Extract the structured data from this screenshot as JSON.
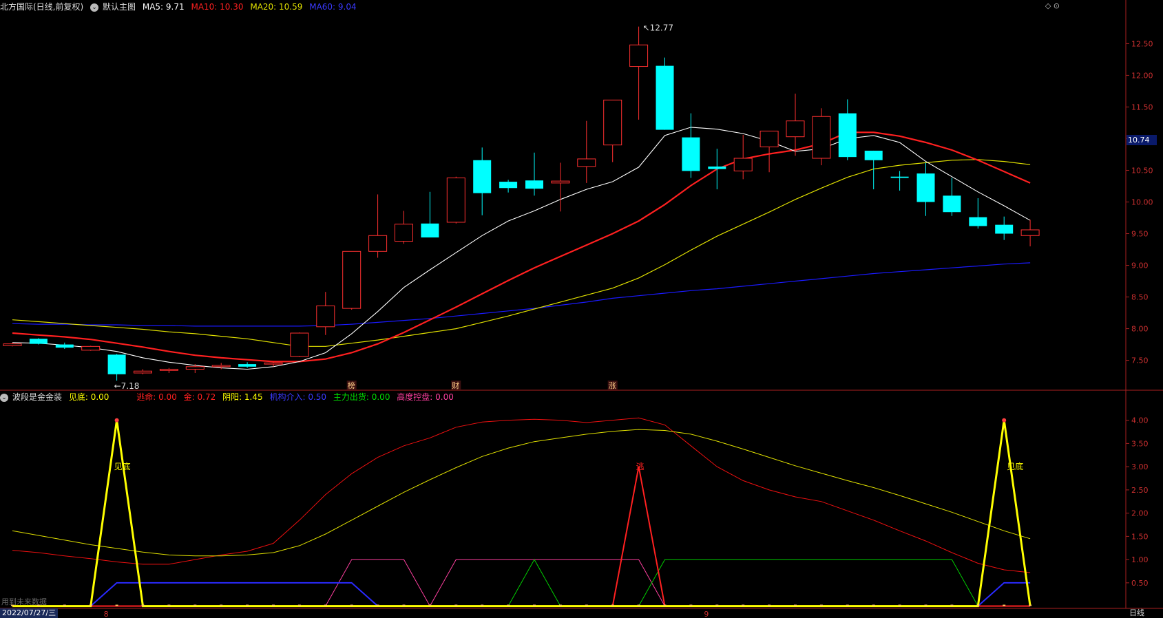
{
  "header": {
    "stock_title": "北方国际(日线,前复权)",
    "chart_mode": "默认主图",
    "ma5_label": "MA5: 9.71",
    "ma10_label": "MA10: 10.30",
    "ma20_label": "MA20: 10.59",
    "ma60_label": "MA60: 9.04"
  },
  "indicator_header": {
    "name": "波段是金金装",
    "items": [
      {
        "label": "见底: 0.00",
        "color": "#ffff00"
      },
      {
        "label": "逃命: 0.00",
        "color": "#ff2020"
      },
      {
        "label": "金: 0.72",
        "color": "#ff2020"
      },
      {
        "label": "阴阳: 1.45",
        "color": "#ffff00"
      },
      {
        "label": "机构介入: 0.50",
        "color": "#3a3aff"
      },
      {
        "label": "主力出货: 0.00",
        "color": "#00e000"
      },
      {
        "label": "高度控盘: 0.00",
        "color": "#ff40a0"
      }
    ]
  },
  "colors": {
    "up": "#ff3030",
    "down": "#00ffff",
    "ma5": "#ffffff",
    "ma10": "#ff2020",
    "ma20": "#e0e000",
    "ma60": "#1a1aff",
    "axis": "#aa2020"
  },
  "current_price": "10.74",
  "footer": {
    "date": "2022/07/27/三",
    "period": "日线",
    "hint": "用到未来数据"
  },
  "markers": [
    {
      "text": "榜",
      "index": 13
    },
    {
      "text": "财",
      "index": 17
    },
    {
      "text": "涨",
      "index": 23
    }
  ],
  "annotations": {
    "high": "12.77",
    "low": "7.18",
    "signal1": "见底",
    "signal2": "逃",
    "signal3": "见底"
  },
  "month_labels": [
    {
      "text": "8",
      "index": 3.5
    },
    {
      "text": "9",
      "index": 26.5
    }
  ],
  "chart_data": [
    {
      "type": "candlestick",
      "x": [
        1,
        2,
        3,
        4,
        5,
        6,
        7,
        8,
        9,
        10,
        11,
        12,
        13,
        14,
        15,
        16,
        17,
        18,
        19,
        20,
        21,
        22,
        23,
        24,
        25,
        26,
        27,
        28,
        29,
        30,
        31,
        32,
        33,
        34,
        35,
        36,
        37,
        38,
        39,
        40
      ],
      "ohlc": [
        [
          7.73,
          7.78,
          7.72,
          7.76
        ],
        [
          7.84,
          7.85,
          7.75,
          7.76
        ],
        [
          7.75,
          7.78,
          7.68,
          7.7
        ],
        [
          7.66,
          7.73,
          7.65,
          7.72
        ],
        [
          7.59,
          7.6,
          7.18,
          7.28
        ],
        [
          7.3,
          7.36,
          7.28,
          7.33
        ],
        [
          7.34,
          7.38,
          7.3,
          7.36
        ],
        [
          7.36,
          7.44,
          7.3,
          7.4
        ],
        [
          7.4,
          7.46,
          7.36,
          7.42
        ],
        [
          7.44,
          7.47,
          7.38,
          7.4
        ],
        [
          7.44,
          7.48,
          7.4,
          7.46
        ],
        [
          7.56,
          7.94,
          7.55,
          7.93
        ],
        [
          8.03,
          8.58,
          7.9,
          8.36
        ],
        [
          8.32,
          9.22,
          8.3,
          9.22
        ],
        [
          9.22,
          10.12,
          9.12,
          9.47
        ],
        [
          9.38,
          9.86,
          9.34,
          9.65
        ],
        [
          9.66,
          10.16,
          9.58,
          9.44
        ],
        [
          9.68,
          10.4,
          9.66,
          10.38
        ],
        [
          10.66,
          10.86,
          9.79,
          10.14
        ],
        [
          10.32,
          10.35,
          10.15,
          10.22
        ],
        [
          10.34,
          10.78,
          10.1,
          10.21
        ],
        [
          10.3,
          10.62,
          9.85,
          10.33
        ],
        [
          10.56,
          11.28,
          10.3,
          10.68
        ],
        [
          10.9,
          11.61,
          10.63,
          11.61
        ],
        [
          12.14,
          12.77,
          11.3,
          12.48
        ],
        [
          12.15,
          12.28,
          11.14,
          11.14
        ],
        [
          11.02,
          11.4,
          10.38,
          10.49
        ],
        [
          10.56,
          10.84,
          10.2,
          10.52
        ],
        [
          10.49,
          11.06,
          10.36,
          10.69
        ],
        [
          10.87,
          11.12,
          10.47,
          11.12
        ],
        [
          11.03,
          11.71,
          10.73,
          11.28
        ],
        [
          10.69,
          11.48,
          10.58,
          11.35
        ],
        [
          11.4,
          11.62,
          10.66,
          10.71
        ],
        [
          10.81,
          10.81,
          10.2,
          10.66
        ],
        [
          10.4,
          10.49,
          10.18,
          10.38
        ],
        [
          10.45,
          10.62,
          9.78,
          10.0
        ],
        [
          10.1,
          10.38,
          9.78,
          9.84
        ],
        [
          9.76,
          10.06,
          9.58,
          9.62
        ],
        [
          9.64,
          9.77,
          9.4,
          9.5
        ],
        [
          9.47,
          9.72,
          9.3,
          9.56
        ]
      ],
      "ma5": [
        7.78,
        7.77,
        7.74,
        7.7,
        7.64,
        7.54,
        7.47,
        7.42,
        7.38,
        7.36,
        7.4,
        7.48,
        7.62,
        7.92,
        8.27,
        8.65,
        8.93,
        9.2,
        9.47,
        9.7,
        9.86,
        10.04,
        10.2,
        10.32,
        10.55,
        11.05,
        11.18,
        11.15,
        11.08,
        10.96,
        10.8,
        10.84,
        11.0,
        11.05,
        10.94,
        10.64,
        10.4,
        10.16,
        9.94,
        9.71
      ],
      "ma10": [
        7.93,
        7.9,
        7.87,
        7.83,
        7.77,
        7.71,
        7.64,
        7.58,
        7.54,
        7.51,
        7.48,
        7.48,
        7.52,
        7.62,
        7.76,
        7.94,
        8.14,
        8.34,
        8.55,
        8.76,
        8.96,
        9.14,
        9.32,
        9.5,
        9.7,
        9.96,
        10.26,
        10.52,
        10.68,
        10.76,
        10.82,
        10.92,
        11.1,
        11.1,
        11.04,
        10.94,
        10.82,
        10.66,
        10.48,
        10.3
      ],
      "ma20": [
        8.14,
        8.11,
        8.08,
        8.05,
        8.02,
        7.99,
        7.95,
        7.92,
        7.88,
        7.84,
        7.78,
        7.72,
        7.72,
        7.77,
        7.82,
        7.88,
        7.94,
        8.0,
        8.1,
        8.2,
        8.31,
        8.42,
        8.53,
        8.64,
        8.8,
        9.01,
        9.24,
        9.46,
        9.65,
        9.84,
        10.04,
        10.22,
        10.39,
        10.52,
        10.58,
        10.62,
        10.66,
        10.67,
        10.64,
        10.59
      ],
      "ma60": [
        8.08,
        8.07,
        8.07,
        8.06,
        8.06,
        8.05,
        8.05,
        8.04,
        8.04,
        8.04,
        8.04,
        8.04,
        8.05,
        8.07,
        8.1,
        8.13,
        8.16,
        8.2,
        8.24,
        8.28,
        8.32,
        8.37,
        8.42,
        8.48,
        8.52,
        8.56,
        8.6,
        8.63,
        8.67,
        8.71,
        8.75,
        8.79,
        8.83,
        8.87,
        8.9,
        8.93,
        8.96,
        8.99,
        9.02,
        9.04
      ],
      "ylim": [
        7.05,
        12.95
      ],
      "y_ticks": [
        "7.50",
        "8.00",
        "8.50",
        "9.00",
        "9.50",
        "10.00",
        "10.50",
        "11.00",
        "11.50",
        "12.00",
        "12.50"
      ]
    },
    {
      "type": "line",
      "x": [
        1,
        2,
        3,
        4,
        5,
        6,
        7,
        8,
        9,
        10,
        11,
        12,
        13,
        14,
        15,
        16,
        17,
        18,
        19,
        20,
        21,
        22,
        23,
        24,
        25,
        26,
        27,
        28,
        29,
        30,
        31,
        32,
        33,
        34,
        35,
        36,
        37,
        38,
        39,
        40
      ],
      "ylim": [
        -0.05,
        4.35
      ],
      "y_ticks": [
        "0.50",
        "1.00",
        "1.50",
        "2.00",
        "2.50",
        "3.00",
        "3.50",
        "4.00"
      ],
      "series": [
        {
          "name": "见底",
          "color": "#ffff00",
          "width": 3,
          "values": [
            0,
            0,
            0,
            0,
            4,
            0,
            0,
            0,
            0,
            0,
            0,
            0,
            0,
            0,
            0,
            0,
            0,
            0,
            0,
            0,
            0,
            0,
            0,
            0,
            0,
            0,
            0,
            0,
            0,
            0,
            0,
            0,
            0,
            0,
            0,
            0,
            0,
            0,
            4,
            0
          ]
        },
        {
          "name": "逃命",
          "color": "#ff2020",
          "width": 2,
          "values": [
            0,
            0,
            0,
            0,
            0,
            0,
            0,
            0,
            0,
            0,
            0,
            0,
            0,
            0,
            0,
            0,
            0,
            0,
            0,
            0,
            0,
            0,
            0,
            0,
            3,
            0,
            0,
            0,
            0,
            0,
            0,
            0,
            0,
            0,
            0,
            0,
            0,
            0,
            0,
            0
          ]
        },
        {
          "name": "金",
          "color": "#ee1010",
          "width": 1,
          "values": [
            1.2,
            1.15,
            1.08,
            1.02,
            0.95,
            0.9,
            0.9,
            1.0,
            1.1,
            1.18,
            1.35,
            1.85,
            2.4,
            2.85,
            3.2,
            3.45,
            3.62,
            3.85,
            3.96,
            4.0,
            4.02,
            4.0,
            3.95,
            4.0,
            4.05,
            3.9,
            3.45,
            3.0,
            2.7,
            2.5,
            2.35,
            2.25,
            2.05,
            1.85,
            1.62,
            1.4,
            1.15,
            0.92,
            0.78,
            0.72
          ]
        },
        {
          "name": "阴阳",
          "color": "#e0e000",
          "width": 1,
          "values": [
            1.62,
            1.52,
            1.42,
            1.32,
            1.24,
            1.16,
            1.1,
            1.08,
            1.08,
            1.1,
            1.15,
            1.3,
            1.55,
            1.85,
            2.15,
            2.45,
            2.72,
            2.98,
            3.22,
            3.4,
            3.54,
            3.62,
            3.7,
            3.76,
            3.8,
            3.78,
            3.7,
            3.55,
            3.38,
            3.2,
            3.02,
            2.86,
            2.7,
            2.55,
            2.38,
            2.2,
            2.02,
            1.82,
            1.62,
            1.45
          ]
        },
        {
          "name": "机构介入",
          "color": "#2a2aff",
          "width": 2,
          "values": [
            0,
            0,
            0,
            0,
            0.5,
            0.5,
            0.5,
            0.5,
            0.5,
            0.5,
            0.5,
            0.5,
            0.5,
            0.5,
            0,
            0,
            0,
            0,
            0,
            0,
            0,
            0,
            0,
            0,
            0,
            0,
            0,
            0,
            0,
            0,
            0,
            0,
            0,
            0,
            0,
            0,
            0,
            0,
            0.5,
            0.5
          ]
        },
        {
          "name": "主力出货",
          "color": "#00d000",
          "width": 1,
          "values": [
            0,
            0,
            0,
            0,
            0,
            0,
            0,
            0,
            0,
            0,
            0,
            0,
            0,
            0,
            0,
            0,
            0,
            0,
            0,
            0,
            1,
            0,
            0,
            0,
            0,
            1,
            1,
            1,
            1,
            1,
            1,
            1,
            1,
            1,
            1,
            1,
            1,
            0,
            0,
            0
          ]
        },
        {
          "name": "高度控盘",
          "color": "#ff40a0",
          "width": 1,
          "values": [
            0,
            0,
            0,
            0,
            0,
            0,
            0,
            0,
            0,
            0,
            0,
            0,
            0,
            1,
            1,
            1,
            0,
            1,
            1,
            1,
            1,
            1,
            1,
            1,
            1,
            0,
            0,
            0,
            0,
            0,
            0,
            0,
            0,
            0,
            0,
            0,
            0,
            0,
            0,
            0
          ]
        }
      ]
    }
  ]
}
